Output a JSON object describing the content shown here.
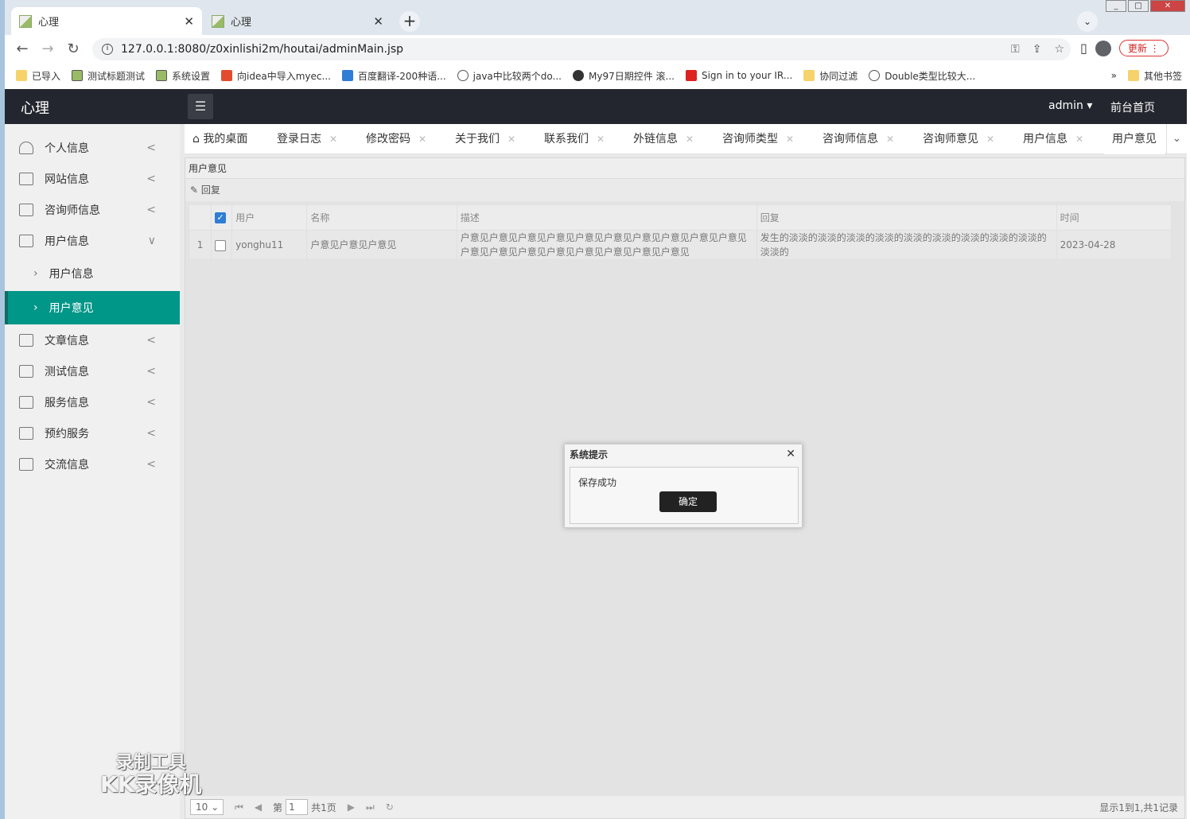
{
  "browser": {
    "tabs": [
      {
        "title": "心理"
      },
      {
        "title": "心理"
      }
    ],
    "url": "127.0.0.1:8080/z0xinlishi2m/houtai/adminMain.jsp",
    "update_label": "更新",
    "bookmarks": [
      "已导入",
      "测试标题测试",
      "系统设置",
      "向idea中导入myec...",
      "百度翻译-200种语...",
      "java中比较两个do...",
      "My97日期控件 滚...",
      "Sign in to your IR...",
      "协同过滤",
      "Double类型比较大..."
    ],
    "bookmarks_more": "»",
    "other_bookmarks": "其他书签"
  },
  "app": {
    "logo": "心理",
    "user": "admin",
    "front_link": "前台首页"
  },
  "sidebar": {
    "items": [
      {
        "label": "个人信息",
        "arrow": "<"
      },
      {
        "label": "网站信息",
        "arrow": "<"
      },
      {
        "label": "咨询师信息",
        "arrow": "<"
      },
      {
        "label": "用户信息",
        "arrow": "∨"
      },
      {
        "label": "文章信息",
        "arrow": "<"
      },
      {
        "label": "测试信息",
        "arrow": "<"
      },
      {
        "label": "服务信息",
        "arrow": "<"
      },
      {
        "label": "预约服务",
        "arrow": "<"
      },
      {
        "label": "交流信息",
        "arrow": "<"
      }
    ],
    "subitems": [
      {
        "label": "用户信息"
      },
      {
        "label": "用户意见"
      }
    ]
  },
  "page_tabs": [
    "我的桌面",
    "登录日志",
    "修改密码",
    "关于我们",
    "联系我们",
    "外链信息",
    "咨询师类型",
    "咨询师信息",
    "咨询师意见",
    "用户信息",
    "用户意见"
  ],
  "panel": {
    "title": "用户意见",
    "reply_button": "回复",
    "columns": [
      "用户",
      "名称",
      "描述",
      "回复",
      "时间"
    ],
    "rows": [
      {
        "num": "1",
        "user": "yonghu11",
        "name": "户意见户意见户意见",
        "desc": "户意见户意见户意见户意见户意见户意见户意见户意见户意见户意见户意见户意见户意见户意见户意见户意见户意见户意见",
        "reply": "发生的淡淡的淡淡的淡淡的淡淡的淡淡的淡淡的淡淡的淡淡的淡淡的淡淡的",
        "time": "2023-04-28"
      }
    ]
  },
  "pager": {
    "page_size": "10",
    "page_prefix": "第",
    "page_value": "1",
    "page_total": "共1页",
    "info": "显示1到1,共1记录"
  },
  "dialog": {
    "title": "系统提示",
    "message": "保存成功",
    "ok_label": "确定"
  },
  "watermark": {
    "line1": "录制工具",
    "line2": "KK录像机"
  }
}
